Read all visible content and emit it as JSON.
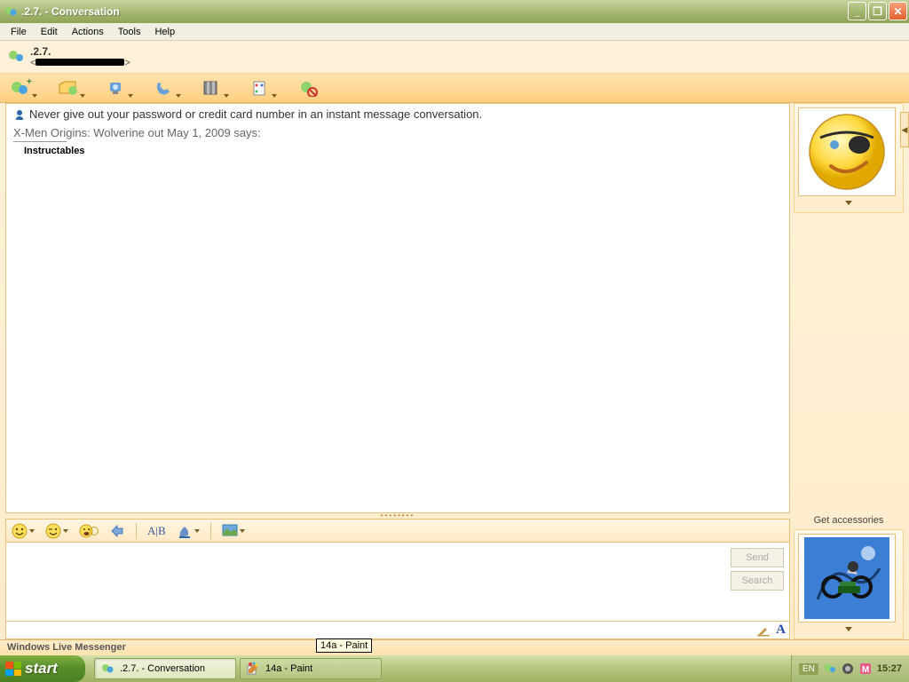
{
  "window": {
    "title": ".2.7. - Conversation"
  },
  "menu": {
    "items": [
      "File",
      "Edit",
      "Actions",
      "Tools",
      "Help"
    ]
  },
  "contact": {
    "name": ".2.7."
  },
  "toolbar": {
    "icons": [
      "invite-icon",
      "share-files-icon",
      "video-call-icon",
      "voice-call-icon",
      "activities-icon",
      "games-icon",
      "block-icon"
    ]
  },
  "conversation": {
    "warning": "Never give out your password or credit card number in an instant message conversation.",
    "sender_line": "X-Men Origins: Wolverine out May 1, 2009 says:",
    "message": "Instructables"
  },
  "compose": {
    "buttons": {
      "send": "Send",
      "search": "Search"
    }
  },
  "right": {
    "get_accessories": "Get accessories"
  },
  "branding": {
    "text": "Windows Live Messenger",
    "tooltip": "14a - Paint"
  },
  "taskbar": {
    "start": "start",
    "buttons": [
      {
        "label": ".2.7. - Conversation",
        "active": true
      },
      {
        "label": "14a - Paint",
        "active": false
      }
    ],
    "lang": "EN",
    "clock": "15:27"
  }
}
